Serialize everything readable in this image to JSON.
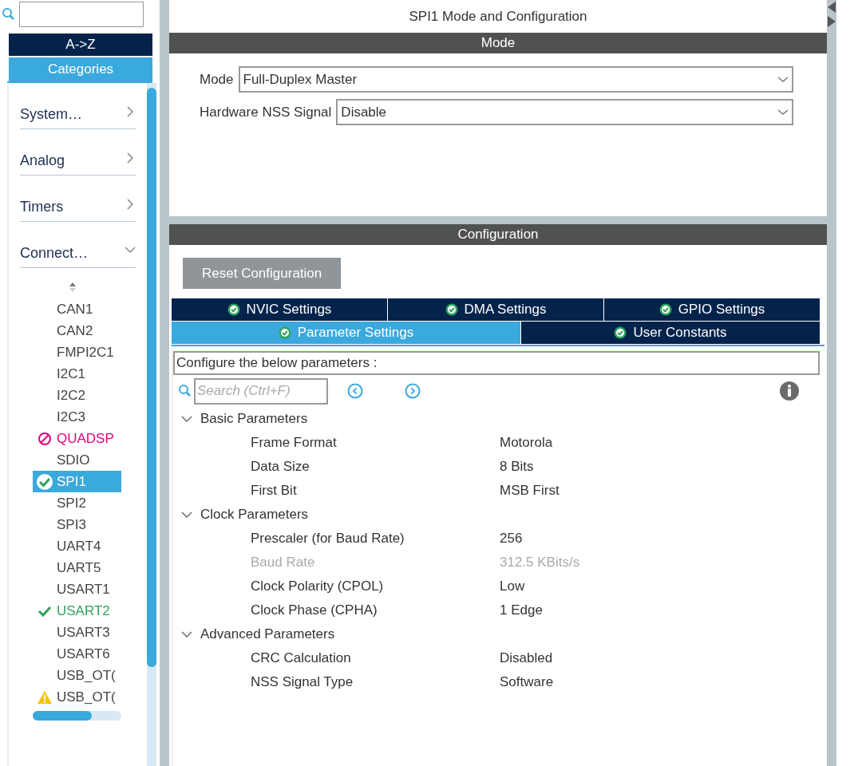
{
  "sidebar": {
    "sort_tabs": [
      {
        "label": "A->Z",
        "selected": false
      },
      {
        "label": "Categories",
        "selected": true
      }
    ],
    "categories": [
      {
        "label": "System…",
        "expanded": false
      },
      {
        "label": "Analog",
        "expanded": false
      },
      {
        "label": "Timers",
        "expanded": false
      },
      {
        "label": "Connect…",
        "expanded": true,
        "items": [
          {
            "label": "CAN1",
            "kind": "plain",
            "selected": false
          },
          {
            "label": "CAN2",
            "kind": "plain",
            "selected": false
          },
          {
            "label": "FMPI2C1",
            "kind": "plain",
            "selected": false
          },
          {
            "label": "I2C1",
            "kind": "plain",
            "selected": false
          },
          {
            "label": "I2C2",
            "kind": "plain",
            "selected": false
          },
          {
            "label": "I2C3",
            "kind": "plain",
            "selected": false
          },
          {
            "label": "QUADSP",
            "kind": "blocked",
            "selected": false
          },
          {
            "label": "SDIO",
            "kind": "plain",
            "selected": false
          },
          {
            "label": "SPI1",
            "kind": "configured",
            "selected": true
          },
          {
            "label": "SPI2",
            "kind": "plain",
            "selected": false
          },
          {
            "label": "SPI3",
            "kind": "plain",
            "selected": false
          },
          {
            "label": "UART4",
            "kind": "plain",
            "selected": false
          },
          {
            "label": "UART5",
            "kind": "plain",
            "selected": false
          },
          {
            "label": "USART1",
            "kind": "plain",
            "selected": false
          },
          {
            "label": "USART2",
            "kind": "enabled",
            "selected": false
          },
          {
            "label": "USART3",
            "kind": "plain",
            "selected": false
          },
          {
            "label": "USART6",
            "kind": "plain",
            "selected": false
          },
          {
            "label": "USB_OT(",
            "kind": "plain",
            "selected": false
          },
          {
            "label": "USB_OT(",
            "kind": "warning",
            "selected": false
          }
        ]
      }
    ]
  },
  "main": {
    "title": "SPI1 Mode and Configuration",
    "mode": {
      "header": "Mode",
      "fields": [
        {
          "label": "Mode",
          "value": "Full-Duplex Master"
        },
        {
          "label": "Hardware NSS Signal",
          "value": "Disable"
        }
      ]
    },
    "configuration": {
      "header": "Configuration",
      "reset_button": "Reset Configuration",
      "tab_rows": [
        [
          {
            "label": "NVIC Settings",
            "selected": false
          },
          {
            "label": "DMA Settings",
            "selected": false
          },
          {
            "label": "GPIO Settings",
            "selected": false
          }
        ],
        [
          {
            "label": "Parameter Settings",
            "selected": true
          },
          {
            "label": "User Constants",
            "selected": false
          }
        ]
      ],
      "description": "Configure the below parameters :",
      "search": {
        "placeholder": "Search (Ctrl+F)"
      },
      "groups": [
        {
          "label": "Basic Parameters",
          "expanded": true,
          "params": [
            {
              "name": "Frame Format",
              "value": "Motorola",
              "disabled": false
            },
            {
              "name": "Data Size",
              "value": "8 Bits",
              "disabled": false
            },
            {
              "name": "First Bit",
              "value": "MSB First",
              "disabled": false
            }
          ]
        },
        {
          "label": "Clock Parameters",
          "expanded": true,
          "params": [
            {
              "name": "Prescaler (for Baud Rate)",
              "value": "256",
              "disabled": false
            },
            {
              "name": "Baud Rate",
              "value": "312.5 KBits/s",
              "disabled": true
            },
            {
              "name": "Clock Polarity (CPOL)",
              "value": "Low",
              "disabled": false
            },
            {
              "name": "Clock Phase (CPHA)",
              "value": "1 Edge",
              "disabled": false
            }
          ]
        },
        {
          "label": "Advanced Parameters",
          "expanded": true,
          "params": [
            {
              "name": "CRC Calculation",
              "value": "Disabled",
              "disabled": false
            },
            {
              "name": "NSS Signal Type",
              "value": "Software",
              "disabled": false
            }
          ]
        }
      ]
    }
  }
}
